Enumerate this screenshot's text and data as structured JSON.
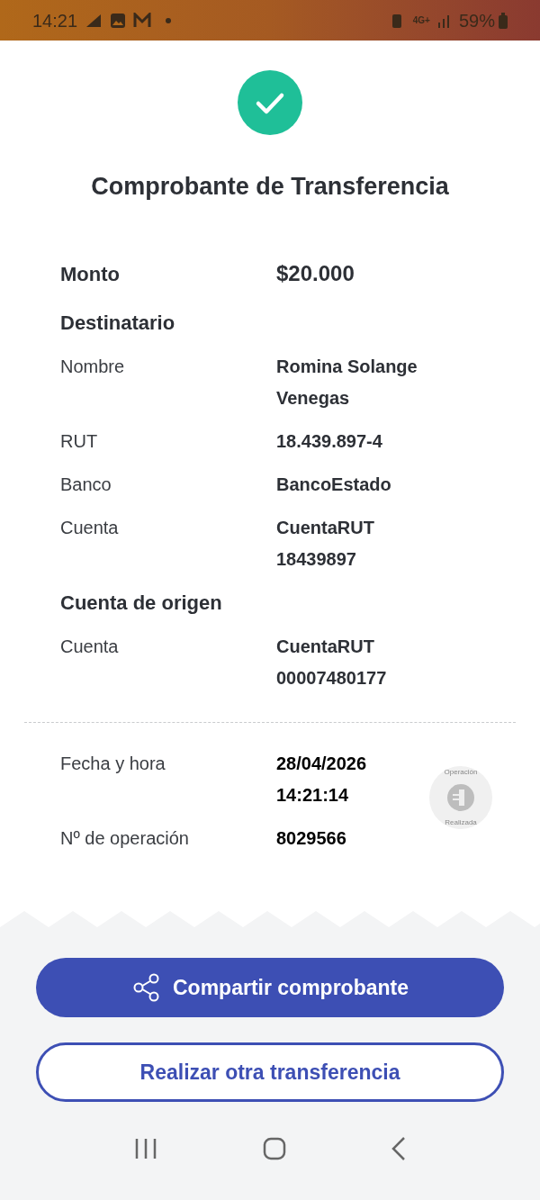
{
  "status_bar": {
    "time": "14:21",
    "network": "4G+",
    "battery": "59%"
  },
  "title": "Comprobante de Transferencia",
  "amount": {
    "label": "Monto",
    "value": "$20.000"
  },
  "sections": [
    {
      "heading": "Destinatario",
      "rows": [
        {
          "label": "Nombre",
          "value": "Romina Solange Venegas"
        },
        {
          "label": "RUT",
          "value": "18.439.897-4"
        },
        {
          "label": "Banco",
          "value": "BancoEstado"
        },
        {
          "label": "Cuenta",
          "value": "CuentaRUT 18439897"
        }
      ]
    },
    {
      "heading": "Cuenta de origen",
      "rows": [
        {
          "label": "Cuenta",
          "value": "CuentaRUT 00007480177"
        }
      ]
    }
  ],
  "details": [
    {
      "label": "Fecha y hora",
      "value": "28/04/2026 14:21:14"
    },
    {
      "label": "Nº de operación",
      "value": "8029566"
    }
  ],
  "stamp": {
    "top": "Operación",
    "bottom": "Realizada"
  },
  "buttons": [
    {
      "label": "Compartir comprobante",
      "kind": "primary"
    },
    {
      "label": "Realizar otra transferencia",
      "kind": "outline"
    }
  ]
}
